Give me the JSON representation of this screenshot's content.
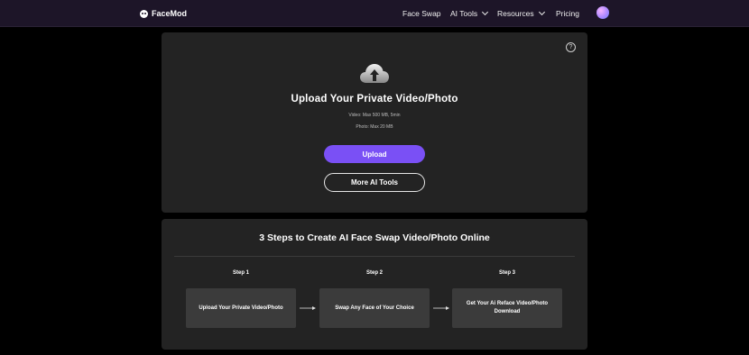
{
  "nav": {
    "brand": "FaceMod",
    "items": [
      {
        "label": "Face Swap"
      },
      {
        "label": "AI Tools"
      },
      {
        "label": "Resources"
      },
      {
        "label": "Pricing"
      }
    ]
  },
  "upload": {
    "help": "?",
    "title": "Upload Your Private Video/Photo",
    "video_limit": "Video: Max 500 MB, 5min",
    "photo_limit": "Photo: Max 20 MB",
    "upload_button": "Upload",
    "more_button": "More AI Tools"
  },
  "steps": {
    "title": "3 Steps to Create AI Face Swap Video/Photo Online",
    "list": [
      {
        "label": "Step 1",
        "text": "Upload Your Private Video/Photo"
      },
      {
        "label": "Step 2",
        "text": "Swap Any Face of Your Choice"
      },
      {
        "label": "Step 3",
        "text": "Get Your Ai Reface Video/Photo Download"
      }
    ]
  },
  "colors": {
    "nav_bg": "#1d1528",
    "card_bg": "#232323",
    "accent": "#7a50f5",
    "step_box": "#3b3b3b"
  },
  "icons": [
    "facemod-logo-icon",
    "chevron-down-icon",
    "avatar",
    "help-icon",
    "cloud-upload-icon",
    "arrow-right-icon"
  ]
}
